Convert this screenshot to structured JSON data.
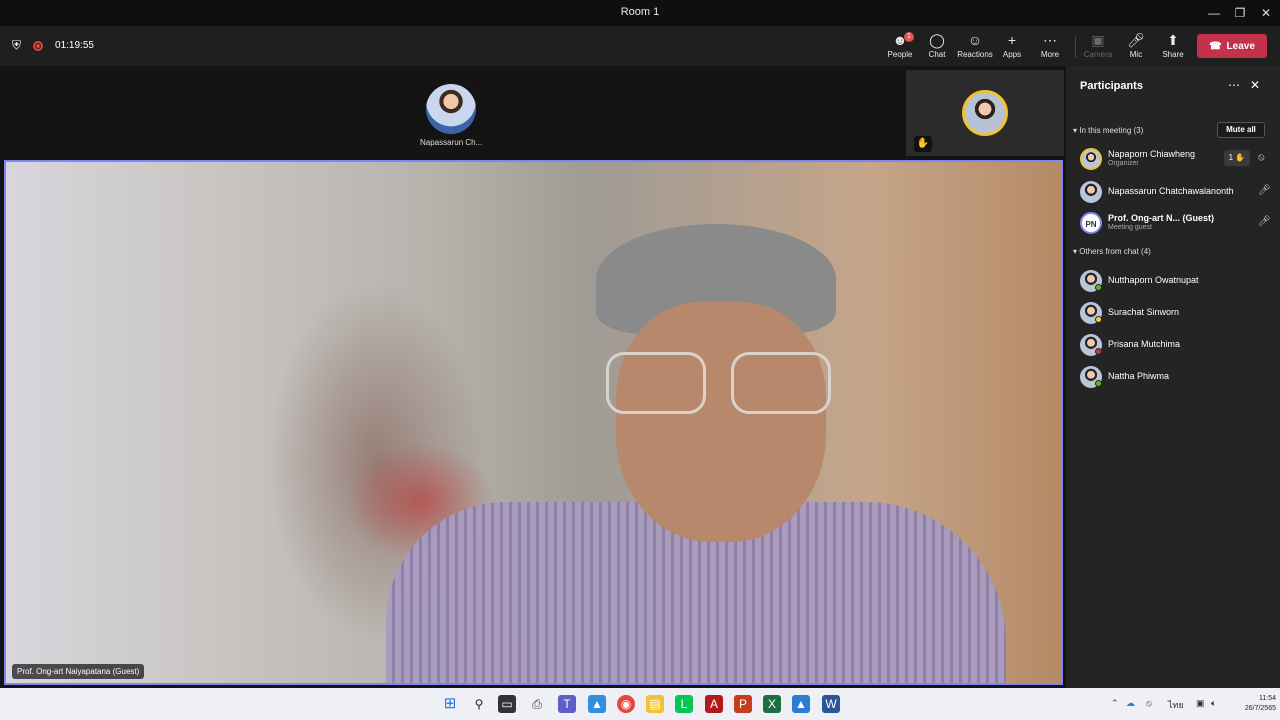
{
  "window": {
    "title": "Room 1"
  },
  "meeting": {
    "timer": "01:19:55"
  },
  "toolbar": {
    "people": "People",
    "people_badge": "1",
    "chat": "Chat",
    "reactions": "Reactions",
    "apps": "Apps",
    "more": "More",
    "camera": "Camera",
    "mic": "Mic",
    "share": "Share",
    "leave": "Leave"
  },
  "stage": {
    "top_tile_name": "Napassarun Ch...",
    "main_video_label": "Prof. Ong-art Naiyapatana (Guest)"
  },
  "participants": {
    "title": "Participants",
    "in_meeting_label": "In this meeting (3)",
    "mute_all": "Mute all",
    "in_meeting": [
      {
        "name": "Napaporn Chiawheng",
        "sub": "Organizer",
        "hand_count": "1"
      },
      {
        "name": "Napassarun Chatchawalanonth",
        "sub": ""
      },
      {
        "name": "Prof. Ong-art N...  (Guest)",
        "sub": "Meeting guest",
        "initials": "PN"
      }
    ],
    "others_label": "Others from chat (4)",
    "others": [
      {
        "name": "Nutthaporn Owatnupat",
        "status_color": "#6bb700"
      },
      {
        "name": "Surachat Sinworn",
        "status_color": "#f8d22a"
      },
      {
        "name": "Prisana Mutchima",
        "status_color": "#c4314b"
      },
      {
        "name": "Nattha Phiwma",
        "status_color": "#6bb700"
      }
    ]
  },
  "taskbar": {
    "lang": "ไทย",
    "time": "11:54",
    "date": "26/7/2565"
  },
  "colors": {
    "accent": "#7f85f5",
    "leave": "#c4314b",
    "hand": "#f1c232"
  }
}
